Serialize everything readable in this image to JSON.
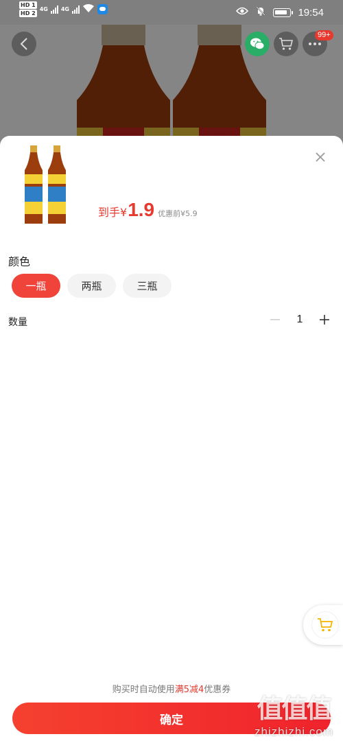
{
  "status_bar": {
    "hd1": "HD 1",
    "hd2": "HD 2",
    "net1": "4G",
    "net2": "4G",
    "time": "19:54",
    "icons": [
      "signal-icon",
      "wifi-icon",
      "app-notification-icon",
      "eye-icon",
      "mute-bell-icon",
      "battery-icon"
    ]
  },
  "nav": {
    "cart_badge": "99+",
    "icons": [
      "back-icon",
      "wechat-icon",
      "cart-icon",
      "more-icon"
    ]
  },
  "product": {
    "price_prefix": "到手¥",
    "price_value": "1.9",
    "original_price": "优惠前¥5.9"
  },
  "spec": {
    "color_title": "颜色",
    "options": [
      "一瓶",
      "两瓶",
      "三瓶"
    ],
    "selected_index": 0,
    "quantity_title": "数量",
    "quantity_value": "1"
  },
  "footer": {
    "coupon_pre": "购买时自动使用",
    "coupon_highlight": "满5减4",
    "coupon_post": "优惠券",
    "confirm_label": "确定"
  },
  "watermark": {
    "mark": "值值值",
    "text": "zhizhizhi.com"
  },
  "colors": {
    "accent": "#e8392e",
    "wechat": "#2aae67",
    "cart_icon": "#f5b400"
  }
}
